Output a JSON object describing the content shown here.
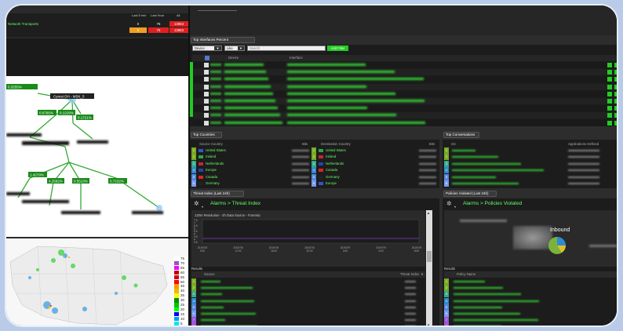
{
  "alarms": {
    "columns": [
      "Last 5 min",
      "Last Hour",
      "All"
    ],
    "row_label": "Network Transports",
    "row1": [
      "0",
      "76",
      "13863"
    ],
    "row2": [
      "5",
      "76",
      "13863"
    ]
  },
  "tree_labels": {
    "root": "Cyrest DH - MSK_5",
    "l1": "0.3255%",
    "l2": "0.8766%",
    "l3": "0.1229%",
    "l4": "0.1721%",
    "l5": "1.4279%",
    "l6": "4.2592%",
    "l7": "0.5513%",
    "l8": "0.7232%"
  },
  "map_legend": [
    "75",
    "70",
    "65",
    "60",
    "55",
    "50",
    "45",
    "40",
    "35",
    "30",
    "25",
    "20",
    "15",
    "10",
    "5"
  ],
  "top_interfaces": {
    "title": "Top Interfaces Percent",
    "filter_field": "Device",
    "filter_op": "Like",
    "search_placeholder": "Search",
    "add_filter": "Add Filter",
    "col_device": "Device",
    "col_interface": "Interface"
  },
  "top_countries": {
    "title": "Top Countries",
    "col_source": "Source Country",
    "col_bits": "Bits",
    "col_dest": "Destination Country",
    "col_bits2": "Bits",
    "source": [
      "United States",
      "Ireland",
      "Netherlands",
      "Europe",
      "Canada",
      "Germany"
    ],
    "dest": [
      "United States",
      "Ireland",
      "Netherlands",
      "Canada",
      "Germany",
      "Europe"
    ]
  },
  "top_conversations": {
    "title": "Top Conversations",
    "col_src": "Src",
    "col_apps": "Applications Defined"
  },
  "threat": {
    "title": "Threat Index (Last 24h)",
    "breadcrumb": "Alarms > Threat Index",
    "chart_caption": "120m Resolution - 2h Data Source - Forensic",
    "yticks": [
      "7.5",
      "7",
      "6.5",
      "6",
      "5.5",
      "5",
      "4.5",
      "4",
      "3.5"
    ],
    "xticks": [
      "2019/7/8\n0:00",
      "2019/7/8\n12:00",
      "2019/7/8\n16:00",
      "2019/7/8\n20:00",
      "2019/7/9\n0:00",
      "2019/7/9\n4:00",
      "2019/7/9\n8:00"
    ],
    "results": "Results",
    "col_source": "Source",
    "col_index": "Threat Index"
  },
  "policies": {
    "title": "Policies Violated (Last 24h)",
    "breadcrumb": "Alarms > Policies Violated",
    "pie_label": "Inbound",
    "results": "Results",
    "col_policy": "Policy Name"
  },
  "colors": {
    "accent_green": "#55ff55",
    "alarm_red": "#e02020",
    "alarm_orange": "#f0a020"
  }
}
